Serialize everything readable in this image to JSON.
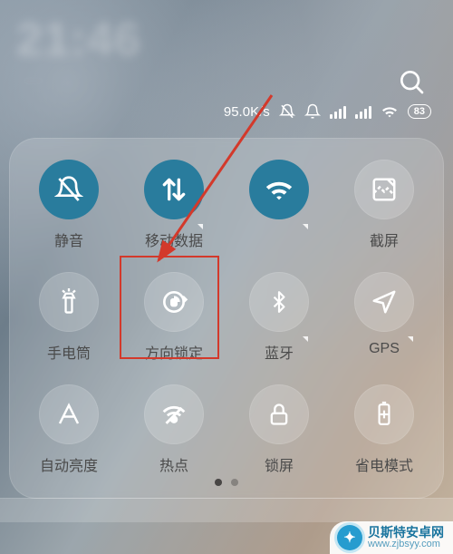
{
  "status": {
    "clock_blur": "21:46",
    "date_blur": "·····",
    "net_rate": "95.0K/s",
    "battery_text": "83"
  },
  "tiles": [
    {
      "id": "mute",
      "label": "静音",
      "on": true
    },
    {
      "id": "data",
      "label": "移动数据",
      "on": true,
      "corner": true
    },
    {
      "id": "wifi",
      "label": "",
      "on": true,
      "corner": true
    },
    {
      "id": "screenshot",
      "label": "截屏",
      "on": false
    },
    {
      "id": "torch",
      "label": "手电筒",
      "on": false
    },
    {
      "id": "orientation",
      "label": "方向锁定",
      "on": false
    },
    {
      "id": "bluetooth",
      "label": "蓝牙",
      "on": false,
      "corner": true
    },
    {
      "id": "gps",
      "label": "GPS",
      "on": false,
      "corner": true
    },
    {
      "id": "autobright",
      "label": "自动亮度",
      "on": false
    },
    {
      "id": "hotspot",
      "label": "热点",
      "on": false
    },
    {
      "id": "lock",
      "label": "锁屏",
      "on": false
    },
    {
      "id": "battery",
      "label": "省电模式",
      "on": false
    }
  ],
  "highlight_tile_id": "orientation",
  "page_indicator": {
    "total": 2,
    "active": 0
  },
  "watermark": {
    "line1": "贝斯特安卓网",
    "line2": "www.zjbsyy.com"
  }
}
